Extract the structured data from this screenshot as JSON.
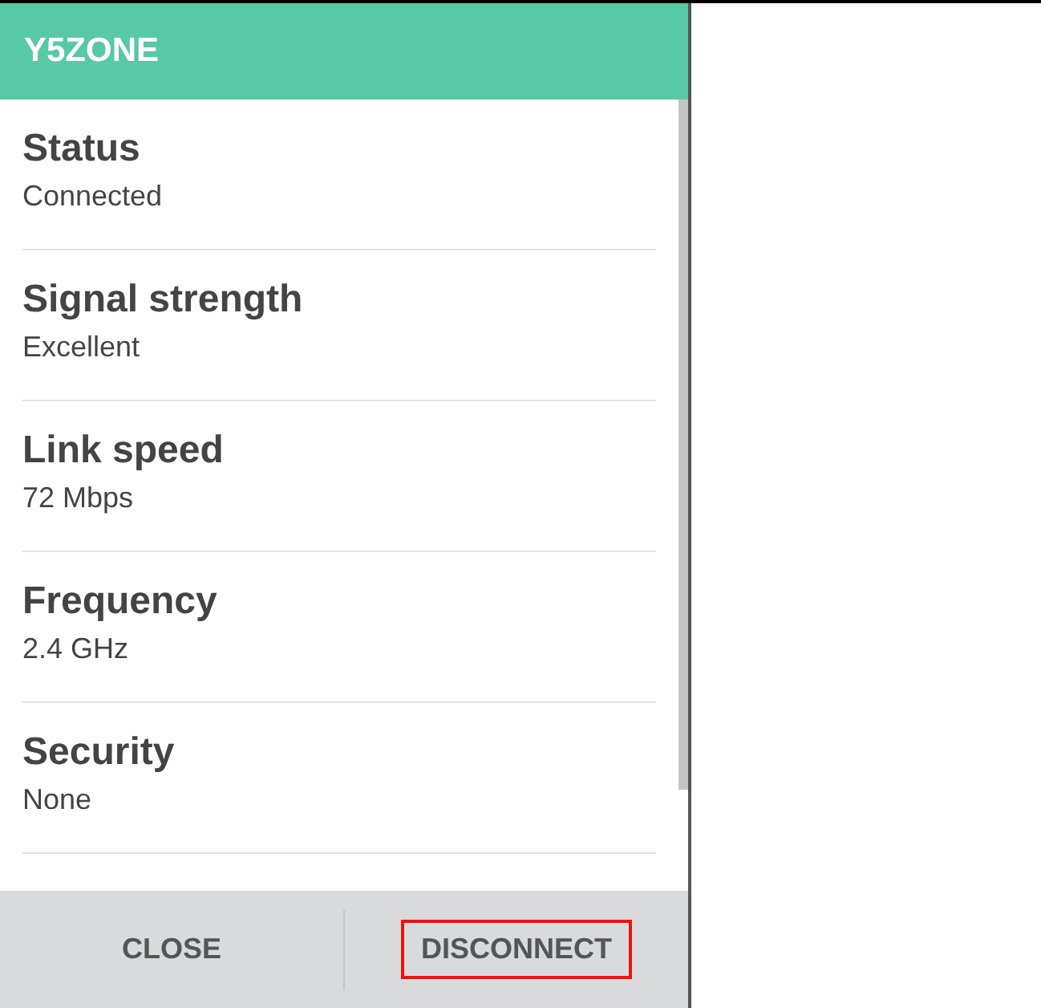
{
  "dialog": {
    "title": "Y5ZONE",
    "fields": [
      {
        "label": "Status",
        "value": "Connected"
      },
      {
        "label": "Signal strength",
        "value": "Excellent"
      },
      {
        "label": "Link speed",
        "value": "72 Mbps"
      },
      {
        "label": "Frequency",
        "value": "2.4 GHz"
      },
      {
        "label": "Security",
        "value": "None"
      }
    ],
    "buttons": [
      {
        "label": "CLOSE",
        "highlighted": false
      },
      {
        "label": "DISCONNECT",
        "highlighted": true
      }
    ]
  }
}
